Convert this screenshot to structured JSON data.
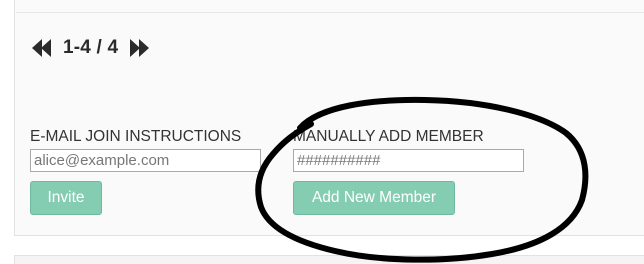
{
  "pager": {
    "range": "1-4 / 4",
    "prev_icon": "rewind-icon",
    "next_icon": "fast-forward-icon"
  },
  "email_join": {
    "label": "E-MAIL JOIN INSTRUCTIONS",
    "placeholder": "alice@example.com",
    "button_label": "Invite"
  },
  "manual_add": {
    "label": "MANUALLY ADD MEMBER",
    "placeholder": "##########",
    "button_label": "Add New Member"
  },
  "colors": {
    "button_bg": "#85cdb2",
    "annotation_stroke": "#000000"
  }
}
